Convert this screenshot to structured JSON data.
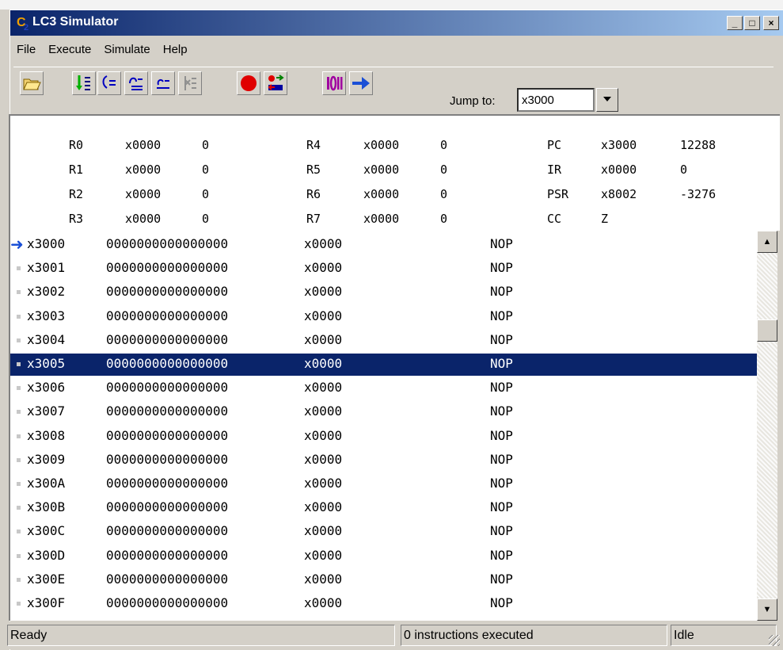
{
  "window": {
    "title": "LC3 Simulator",
    "app_icon": "lc3-app-icon",
    "minimize": "_",
    "maximize": "□",
    "close": "×"
  },
  "menu": [
    "File",
    "Execute",
    "Simulate",
    "Help"
  ],
  "toolbar": {
    "icons": [
      "open-file-icon",
      "step-in-icon",
      "step-over-icon",
      "step-out-icon",
      "run-to-cursor-icon",
      "finish-icon",
      "breakpoint-icon",
      "toggle-breakpoint-icon",
      "binary-view-icon",
      "go-arrow-icon"
    ],
    "jump_label": "Jump to:",
    "jump_value": "x3000"
  },
  "registers": {
    "col1": [
      {
        "name": "R0",
        "hex": "x0000",
        "dec": "0"
      },
      {
        "name": "R1",
        "hex": "x0000",
        "dec": "0"
      },
      {
        "name": "R2",
        "hex": "x0000",
        "dec": "0"
      },
      {
        "name": "R3",
        "hex": "x0000",
        "dec": "0"
      }
    ],
    "col2": [
      {
        "name": "R4",
        "hex": "x0000",
        "dec": "0"
      },
      {
        "name": "R5",
        "hex": "x0000",
        "dec": "0"
      },
      {
        "name": "R6",
        "hex": "x0000",
        "dec": "0"
      },
      {
        "name": "R7",
        "hex": "x0000",
        "dec": "0"
      }
    ],
    "col3": [
      {
        "name": "PC",
        "hex": "x3000",
        "dec": "12288"
      },
      {
        "name": "IR",
        "hex": "x0000",
        "dec": "0"
      },
      {
        "name": "PSR",
        "hex": "x8002",
        "dec": "-3276"
      },
      {
        "name": "CC",
        "hex": "Z",
        "dec": ""
      }
    ]
  },
  "memory": [
    {
      "addr": "x3000",
      "bin": "0000000000000000",
      "hex": "x0000",
      "instr": "NOP",
      "pc": true,
      "selected": false
    },
    {
      "addr": "x3001",
      "bin": "0000000000000000",
      "hex": "x0000",
      "instr": "NOP",
      "pc": false,
      "selected": false
    },
    {
      "addr": "x3002",
      "bin": "0000000000000000",
      "hex": "x0000",
      "instr": "NOP",
      "pc": false,
      "selected": false
    },
    {
      "addr": "x3003",
      "bin": "0000000000000000",
      "hex": "x0000",
      "instr": "NOP",
      "pc": false,
      "selected": false
    },
    {
      "addr": "x3004",
      "bin": "0000000000000000",
      "hex": "x0000",
      "instr": "NOP",
      "pc": false,
      "selected": false
    },
    {
      "addr": "x3005",
      "bin": "0000000000000000",
      "hex": "x0000",
      "instr": "NOP",
      "pc": false,
      "selected": true
    },
    {
      "addr": "x3006",
      "bin": "0000000000000000",
      "hex": "x0000",
      "instr": "NOP",
      "pc": false,
      "selected": false
    },
    {
      "addr": "x3007",
      "bin": "0000000000000000",
      "hex": "x0000",
      "instr": "NOP",
      "pc": false,
      "selected": false
    },
    {
      "addr": "x3008",
      "bin": "0000000000000000",
      "hex": "x0000",
      "instr": "NOP",
      "pc": false,
      "selected": false
    },
    {
      "addr": "x3009",
      "bin": "0000000000000000",
      "hex": "x0000",
      "instr": "NOP",
      "pc": false,
      "selected": false
    },
    {
      "addr": "x300A",
      "bin": "0000000000000000",
      "hex": "x0000",
      "instr": "NOP",
      "pc": false,
      "selected": false
    },
    {
      "addr": "x300B",
      "bin": "0000000000000000",
      "hex": "x0000",
      "instr": "NOP",
      "pc": false,
      "selected": false
    },
    {
      "addr": "x300C",
      "bin": "0000000000000000",
      "hex": "x0000",
      "instr": "NOP",
      "pc": false,
      "selected": false
    },
    {
      "addr": "x300D",
      "bin": "0000000000000000",
      "hex": "x0000",
      "instr": "NOP",
      "pc": false,
      "selected": false
    },
    {
      "addr": "x300E",
      "bin": "0000000000000000",
      "hex": "x0000",
      "instr": "NOP",
      "pc": false,
      "selected": false
    },
    {
      "addr": "x300F",
      "bin": "0000000000000000",
      "hex": "x0000",
      "instr": "NOP",
      "pc": false,
      "selected": false
    }
  ],
  "status": {
    "left": "Ready",
    "middle": "0 instructions executed",
    "right": "Idle"
  },
  "colors": {
    "title_start": "#0a246a",
    "title_end": "#a6caf0",
    "selection": "#0a246a",
    "pc_arrow": "#1a4fd6",
    "breakpoint": "#e00000",
    "step_green": "#00b000"
  }
}
